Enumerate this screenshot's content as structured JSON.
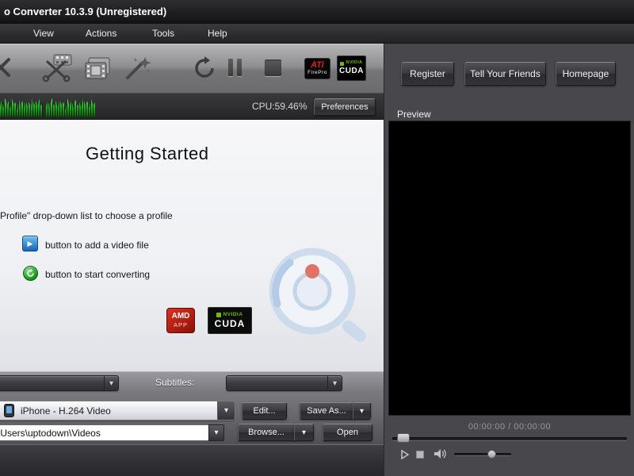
{
  "colors": {
    "waveform_green": "#35e035",
    "nvidia_green": "#76b900",
    "amd_red": "#c41818",
    "ati_red": "#e8192c"
  },
  "icons": {
    "dropdown_arrow": "▾",
    "play": "▶"
  },
  "window": {
    "title": "o Converter 10.3.9 (Unregistered)"
  },
  "menubar": {
    "items": [
      {
        "label": "View"
      },
      {
        "label": "Actions"
      },
      {
        "label": "Tools"
      },
      {
        "label": "Help"
      }
    ]
  },
  "toolbar": {
    "ati_badge": {
      "brand": "ATi",
      "product": "FirePro"
    },
    "cuda_badge": {
      "brand": "NVIDIA",
      "product": "CUDA"
    }
  },
  "status": {
    "cpu": "CPU:59.46%",
    "preferences": "Preferences"
  },
  "links": {
    "register": "Register",
    "tell_friends": "Tell Your Friends",
    "homepage": "Homepage"
  },
  "getting_started": {
    "title": "Getting Started",
    "step_profile": "Profile\" drop-down list to choose a profile",
    "step_add": "button to add a video file",
    "step_convert": "button to start converting"
  },
  "tech_badges": {
    "amd": {
      "brand": "AMD",
      "product": "APP"
    },
    "nvidia": {
      "brand": "NVIDIA",
      "product": "CUDA"
    }
  },
  "preview": {
    "label": "Preview",
    "time": "00:00:00 / 00:00:00"
  },
  "subtitles": {
    "label": "Subtitles:"
  },
  "profile": {
    "value": "iPhone - H.264 Video",
    "edit": "Edit...",
    "save_as": "Save As..."
  },
  "output": {
    "path": "C:\\Users\\uptodown\\Videos",
    "browse": "Browse...",
    "open": "Open"
  }
}
